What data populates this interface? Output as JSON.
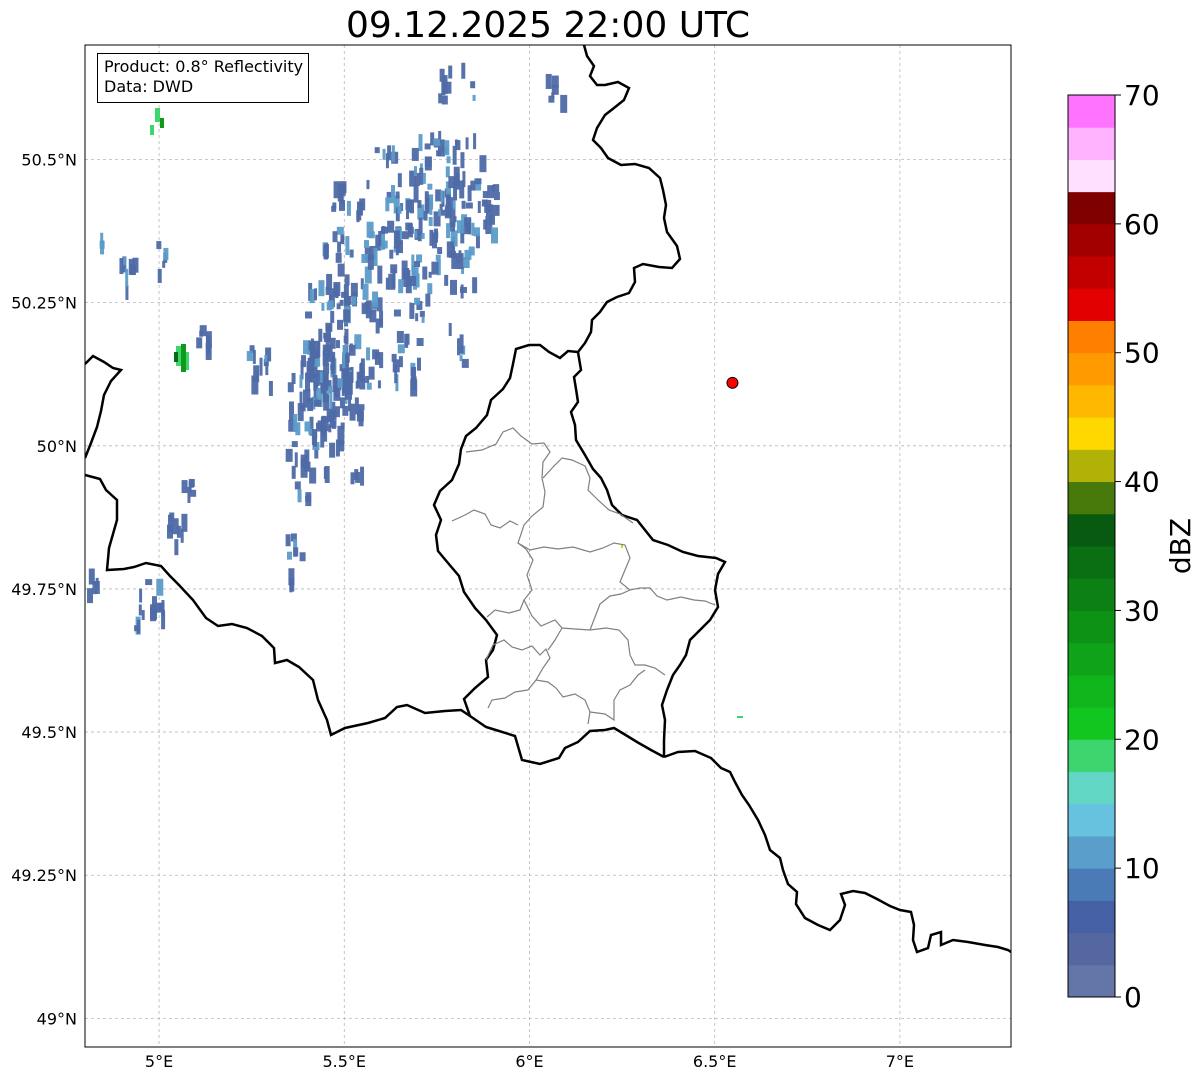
{
  "title": "09.12.2025 22:00 UTC",
  "info": {
    "product": "Product: 0.8° Reflectivity",
    "data": "Data: DWD"
  },
  "map": {
    "lon_range": [
      4.8,
      7.3
    ],
    "lat_range": [
      48.95,
      50.7
    ],
    "lon_ticks": [
      {
        "value": 5.0,
        "label": "5°E"
      },
      {
        "value": 5.5,
        "label": "5.5°E"
      },
      {
        "value": 6.0,
        "label": "6°E"
      },
      {
        "value": 6.5,
        "label": "6.5°E"
      },
      {
        "value": 7.0,
        "label": "7°E"
      }
    ],
    "lat_ticks": [
      {
        "value": 49.0,
        "label": "49°N"
      },
      {
        "value": 49.25,
        "label": "49.25°N"
      },
      {
        "value": 49.5,
        "label": "49.5°N"
      },
      {
        "value": 49.75,
        "label": "49.75°N"
      },
      {
        "value": 50.0,
        "label": "50°N"
      },
      {
        "value": 50.25,
        "label": "50.25°N"
      },
      {
        "value": 50.5,
        "label": "50.5°N"
      }
    ],
    "grid": true,
    "radar_site": {
      "lon": 6.548,
      "lat": 50.11,
      "color": "#ff0000"
    },
    "echo_colors": {
      "low": "#4e6aa6",
      "mid": "#5b9bc8",
      "high": "#3dd66e",
      "core": "#0f9a1a",
      "dark": "#0a6a12"
    }
  },
  "colorbar": {
    "label": "dBZ",
    "min": 0,
    "max": 70,
    "step": 2.5,
    "tick_values": [
      0,
      10,
      20,
      30,
      40,
      50,
      60,
      70
    ],
    "tick_labels": [
      "0",
      "10",
      "20",
      "30",
      "40",
      "50",
      "60",
      "70"
    ],
    "colors": [
      "#6475a8",
      "#5567a0",
      "#4560a5",
      "#4a7bb6",
      "#5a9fcc",
      "#67c2e0",
      "#62d6c4",
      "#3dd66e",
      "#11c61e",
      "#0fb51a",
      "#0ea318",
      "#0d9216",
      "#0c8014",
      "#0a6f12",
      "#075a10",
      "#47790b",
      "#b1b207",
      "#ffd800",
      "#ffb800",
      "#ff9a00",
      "#ff8000",
      "#e30000",
      "#c20000",
      "#a20000",
      "#800000",
      "#ffe0ff",
      "#ffb3ff",
      "#ff73ff",
      "#ee3aee"
    ]
  }
}
